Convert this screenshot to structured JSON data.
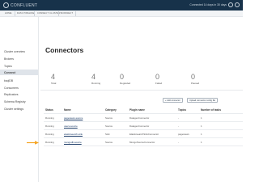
{
  "brand": {
    "name": "CONFLUENT",
    "trial_text": "Connected 14 days in 30 days"
  },
  "breadcrumb": [
    "HOME",
    "DATA PIPELINE",
    "CONNECT CLUSTERS",
    "CONNECT"
  ],
  "sidebar": {
    "items": [
      {
        "label": "Cluster overview"
      },
      {
        "label": "Brokers"
      },
      {
        "label": "Topics"
      },
      {
        "label": "Connect"
      },
      {
        "label": "ksqlDB"
      },
      {
        "label": "Consumers"
      },
      {
        "label": "Replicators"
      },
      {
        "label": "Schema Registry"
      },
      {
        "label": "Cluster settings"
      }
    ],
    "active_index": 3
  },
  "page": {
    "title": "Connectors"
  },
  "stats": [
    {
      "value": "4",
      "label": "Total"
    },
    {
      "value": "4",
      "label": "Running"
    },
    {
      "value": "0",
      "label": "Degraded"
    },
    {
      "value": "0",
      "label": "Failed"
    },
    {
      "value": "0",
      "label": "Paused"
    }
  ],
  "actions": {
    "add_label": "+ Add connector",
    "upload_label": "Upload connector config file"
  },
  "table": {
    "headers": [
      "Status",
      "Name",
      "Category",
      "Plugin name",
      "Topics",
      "Number of tasks"
    ],
    "rows": [
      [
        "Running",
        "pageviews-source",
        "Source",
        "DatagenConnector",
        "-",
        "1"
      ],
      [
        "Running",
        "users-source",
        "Source",
        "DatagenConnector",
        "-",
        "1"
      ],
      [
        "Running",
        "elasticsearch-sink",
        "Sink",
        "ElasticsearchSinkConnector",
        "pageviews",
        "1"
      ],
      [
        "Running",
        "mongodb-source",
        "Source",
        "MongoSourceConnector",
        "-",
        "1"
      ]
    ]
  },
  "colors": {
    "topbar": "#17324a",
    "arrow": "#f5a524",
    "link": "#1a3a66"
  }
}
